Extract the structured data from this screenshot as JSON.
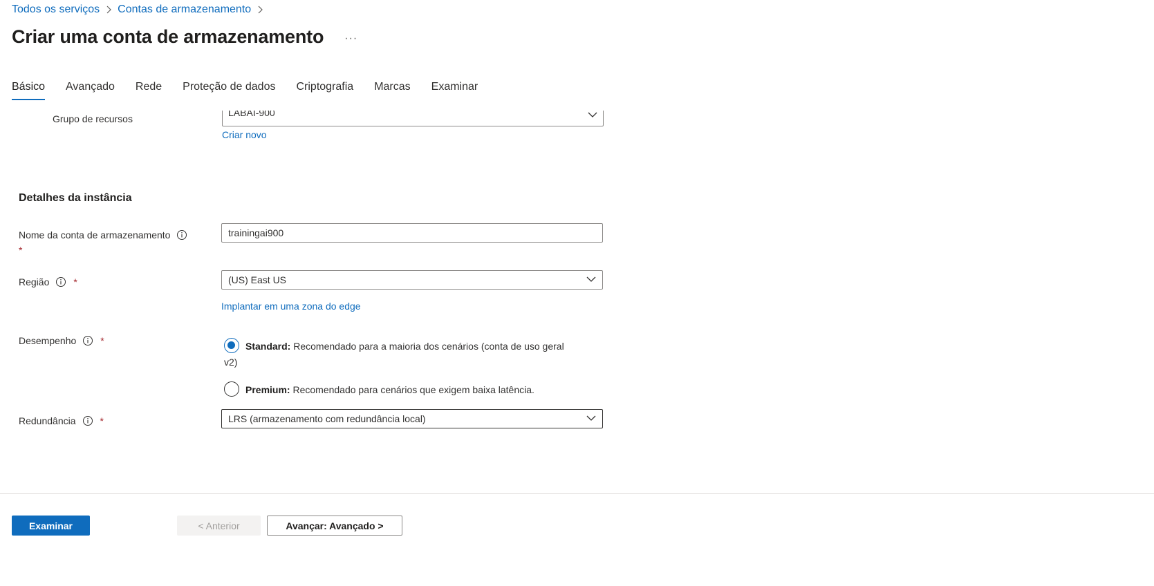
{
  "breadcrumb": {
    "items": [
      "Todos os serviços",
      "Contas de armazenamento"
    ]
  },
  "header": {
    "title": "Criar uma conta de armazenamento",
    "more_label": "···"
  },
  "tabs": [
    {
      "label": "Básico",
      "active": true
    },
    {
      "label": "Avançado",
      "active": false
    },
    {
      "label": "Rede",
      "active": false
    },
    {
      "label": "Proteção de dados",
      "active": false
    },
    {
      "label": "Criptografia",
      "active": false
    },
    {
      "label": "Marcas",
      "active": false
    },
    {
      "label": "Examinar",
      "active": false
    }
  ],
  "resource_group": {
    "label": "Grupo de recursos",
    "value": "LABAI-900",
    "create_new_label": "Criar novo"
  },
  "instance_details": {
    "section_title": "Detalhes da instância",
    "storage_name": {
      "label": "Nome da conta de armazenamento",
      "required_mark": "*",
      "value": "trainingai900"
    },
    "region": {
      "label": "Região",
      "required_mark": "*",
      "value": "(US) East US",
      "edge_link": "Implantar em uma zona do edge"
    },
    "performance": {
      "label": "Desempenho",
      "required_mark": "*",
      "options": [
        {
          "title": "Standard:",
          "desc": "Recomendado para a maioria dos cenários (conta de uso geral",
          "desc_wrap": "v2)",
          "selected": true
        },
        {
          "title": "Premium:",
          "desc": "Recomendado para cenários que exigem baixa latência.",
          "selected": false
        }
      ]
    },
    "redundancy": {
      "label": "Redundância",
      "required_mark": "*",
      "value": "LRS (armazenamento com redundância local)"
    }
  },
  "footer": {
    "review_label": "Examinar",
    "previous_label": "< Anterior",
    "next_label": "Avançar: Avançado >"
  },
  "colors": {
    "accent": "#0f6cbd",
    "required": "#a4262c",
    "text": "#323130"
  }
}
